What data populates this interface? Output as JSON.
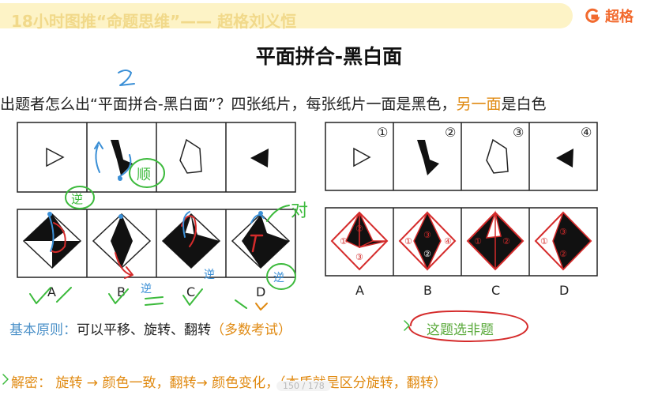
{
  "header": {
    "course_title": "18小时图推“命题思维”—— 超格刘义恒",
    "brand": "超格",
    "brand_color": "#f26a2e"
  },
  "slide": {
    "title": "平面拼合-黑白面",
    "question": {
      "part1": "出题者怎么出“平面拼合-黑白面”？四张纸片，每张纸片一面是黑色，",
      "part2": "另一面",
      "part3": "是白色"
    },
    "left_options": [
      "A",
      "B",
      "C",
      "D"
    ],
    "right_numbers": [
      "①",
      "②",
      "③",
      "④"
    ],
    "right_options": [
      "A",
      "B",
      "C",
      "D"
    ],
    "principle": {
      "label": "基本原则：",
      "text": "可以平移、旋转、翻转",
      "note": "（多数考试）"
    },
    "answer_note": "这题选非题",
    "secret": "解密：  旋转 → 颜色一致，翻转→ 颜色变化，（本质就是区分旋转，翻转）",
    "page_indicator": "150 / 178"
  },
  "annotations": {
    "ink_blue": "#3a8fd6",
    "ink_green": "#3cba3c",
    "ink_red": "#d52b2b",
    "handwriting": [
      "2",
      "顺",
      "逆",
      "逆",
      "逆",
      "逆",
      "对"
    ]
  }
}
